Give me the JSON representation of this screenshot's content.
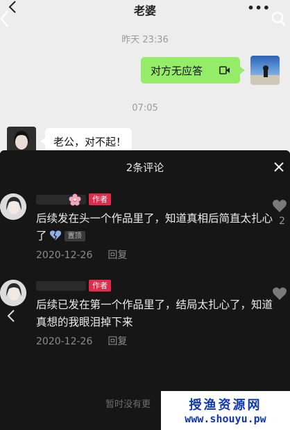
{
  "chat": {
    "title": "老婆",
    "more": "•••",
    "time1": "昨天 23:36",
    "sent_message": "对方无应答",
    "time2": "07:05",
    "received_message": "老公，对不起！"
  },
  "comments_panel": {
    "title": "2条评论",
    "comments": [
      {
        "author_badge": "作者",
        "text": "后续发在头一个作品里了，知道真相后简直太扎心了",
        "pin_label": "置顶",
        "date": "2020-12-26",
        "reply_label": "回复",
        "like_count": "2"
      },
      {
        "author_badge": "作者",
        "text": "后续已发在第一个作品里了，结局太扎心了，知道真想的我眼泪掉下来",
        "date": "2020-12-26",
        "reply_label": "回复"
      }
    ],
    "footer": "暂时没有更"
  },
  "watermark": {
    "line1": "授渔资源网",
    "line2": "www.shouyu.pw"
  },
  "colors": {
    "wechat_green": "#95ec69",
    "author_badge": "#e22b4a",
    "watermark_blue": "#0f36b6"
  },
  "icons": [
    "back-icon",
    "more-icon",
    "search-icon",
    "voice-icon",
    "close-icon",
    "cherry-blossom-icon",
    "broken-heart-icon",
    "heart-icon"
  ]
}
